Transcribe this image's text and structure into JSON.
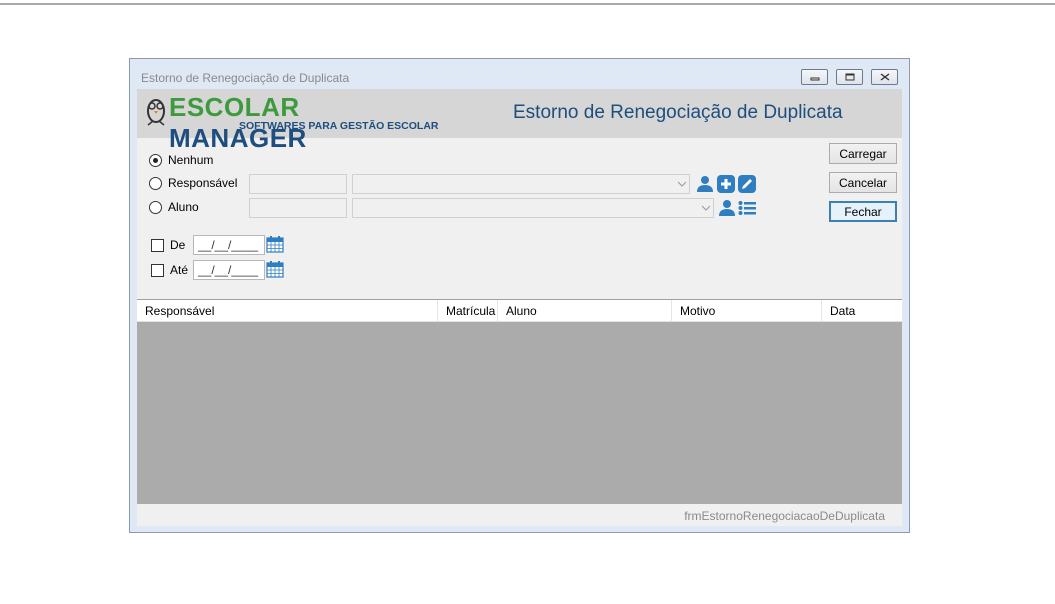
{
  "window": {
    "title": "Estorno de Renegociação de Duplicata",
    "form_title": "Estorno de Renegociação de Duplicata",
    "status_text": "frmEstornoRenegociacaoDeDuplicata"
  },
  "logo": {
    "part1": "ESCOL",
    "part2": "AR",
    "part3": " MANAGER",
    "subtitle": "SOFTWARES PARA GESTÃO ESCOLAR"
  },
  "filters": {
    "options": [
      {
        "label": "Nenhum",
        "selected": true
      },
      {
        "label": "Responsável",
        "selected": false
      },
      {
        "label": "Aluno",
        "selected": false
      }
    ],
    "de_label": "De",
    "ate_label": "Até",
    "de_value": "__/__/____",
    "ate_value": "__/__/____"
  },
  "buttons": {
    "carregar": "Carregar",
    "cancelar": "Cancelar",
    "fechar": "Fechar"
  },
  "grid": {
    "columns": [
      "Responsável",
      "Matrícula",
      "Aluno",
      "Motivo",
      "Data"
    ]
  },
  "colors": {
    "brand_green": "#3e9a3c",
    "brand_blue": "#1d4e7e",
    "icon_blue": "#2f7fc0"
  }
}
